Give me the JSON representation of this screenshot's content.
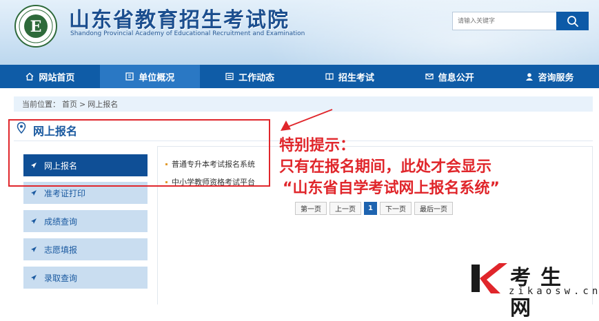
{
  "header": {
    "logo_alt": "山东省教育招生考试院",
    "site_title": "山东省教育招生考试院",
    "site_subtitle": "Shandong Provincial Academy of Educational Recruitment and Examination",
    "search_placeholder": "请输入关键字"
  },
  "nav": {
    "items": [
      {
        "label": "网站首页",
        "icon": "home-icon"
      },
      {
        "label": "单位概况",
        "icon": "building-icon"
      },
      {
        "label": "工作动态",
        "icon": "news-icon"
      },
      {
        "label": "招生考试",
        "icon": "book-icon"
      },
      {
        "label": "信息公开",
        "icon": "mail-icon"
      },
      {
        "label": "咨询服务",
        "icon": "person-icon"
      }
    ],
    "active_index": 1
  },
  "breadcrumb": {
    "prefix": "当前位置：",
    "home": "首页",
    "separator": ">",
    "current": "网上报名"
  },
  "section": {
    "title": "网上报名"
  },
  "sidebar": {
    "items": [
      {
        "label": "网上报名",
        "active": true
      },
      {
        "label": "准考证打印",
        "active": false
      },
      {
        "label": "成绩查询",
        "active": false
      },
      {
        "label": "志愿填报",
        "active": false
      },
      {
        "label": "录取查询",
        "active": false
      }
    ]
  },
  "list": {
    "items": [
      "普通专升本考试报名系统",
      "中小学教师资格考试平台"
    ]
  },
  "pagination": {
    "first": "第一页",
    "prev": "上一页",
    "current": "1",
    "next": "下一页",
    "last": "最后一页"
  },
  "annotation": {
    "line1": "特别提示：",
    "line2": "只有在报名期间，此处才会显示",
    "line3": "“山东省自学考试网上报名系统”",
    "color": "#e0262b"
  },
  "watermark": {
    "brand": "考生网",
    "url": "zikaosw.cn"
  },
  "colors": {
    "nav_bg": "#0f5ca7",
    "nav_active": "#2a78c4",
    "sidebar_active": "#0f4f96",
    "sidebar_bg": "#c9ddf0"
  }
}
